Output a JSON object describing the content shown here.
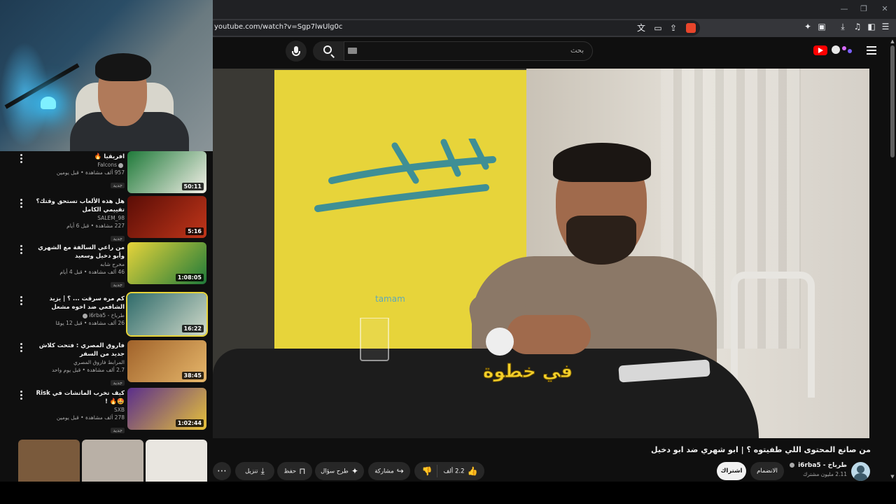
{
  "browser": {
    "url": "youtube.com/watch?v=Sgp7lwUlg0c",
    "window_controls": [
      "—",
      "❐",
      "✕"
    ],
    "toolbar_icons": [
      "translate-icon",
      "cast-icon",
      "share-icon",
      "extensions-icon",
      "screenshot-icon",
      "download-icon",
      "media-icon",
      "sidebar-icon",
      "menu-icon"
    ]
  },
  "header": {
    "search_placeholder": "بحث"
  },
  "recommendations": [
    {
      "title": "افريقيا 🔥",
      "channel": "Falcons",
      "stats": "957 ألف مشاهدة • قبل يومين",
      "badge": "جديد",
      "duration": "50:11",
      "thumb_colors": [
        "#1f7a3a",
        "#f4f0e8"
      ]
    },
    {
      "title": "هل هذه الألعاب تستحق وقتك؟ تقييمي الكامل",
      "channel": "SALEM_98",
      "stats": "227 مشاهدة • قبل 6 أيام",
      "badge": "جديد",
      "duration": "5:16",
      "thumb_colors": [
        "#5a0d06",
        "#c1361a"
      ]
    },
    {
      "title": "من راعي السالفة مع الشهري وأبو دخيل وسعيد",
      "channel": "مخرج شابه",
      "stats": "46 ألف مشاهدة • قبل 4 أيام",
      "badge": "جديد",
      "duration": "1:08:05",
      "thumb_colors": [
        "#e7d43a",
        "#1f7a3a"
      ]
    },
    {
      "title": "كم مره سرقت ... ؟ | يزيد الشافعي ضد اخوه مشعل",
      "channel": "طرباخ - i6rba5",
      "stats": "26 ألف مشاهدة • قبل 12 يومًا",
      "badge": "",
      "duration": "16:22",
      "thumb_colors": [
        "#2f6b6a",
        "#cfd9c9"
      ]
    },
    {
      "title": "فاروق المصري : فتحت كلاش جديد من السفر",
      "channel": "المرابط فاروق المصري",
      "stats": "2.7 ألف مشاهدة • قبل يوم واحد",
      "badge": "جديد",
      "duration": "38:45",
      "thumb_colors": [
        "#a0622a",
        "#e6b76b"
      ]
    },
    {
      "title": "كيف تخرب الماتشات في Risk 🤩🔥 !",
      "channel": "SXB",
      "stats": "278 ألف مشاهدة • قبل يومين",
      "badge": "جديد",
      "duration": "1:02:44",
      "thumb_colors": [
        "#5a2e8c",
        "#e7c23a"
      ]
    }
  ],
  "shorts_colors": [
    "#7a5a3c",
    "#b9b0a6",
    "#e9e6e0"
  ],
  "player": {
    "caption": "في خطوة",
    "sponsor": "tamam"
  },
  "video": {
    "title": "من صانع المحتوى اللي طفيتوه ؟ | ابو شهري ضد ابو دخيل",
    "channel_name": "طرباخ - i6rba5",
    "channel_subs": "2.11 مليون مشترك",
    "join_label": "الانضمام",
    "subscribe_label": "اشتراك",
    "likes_label": "2.2 ألف",
    "share_label": "مشاركة",
    "ask_label": "طرح سؤال",
    "save_label": "حفظ",
    "download_label": "تنزيل"
  }
}
